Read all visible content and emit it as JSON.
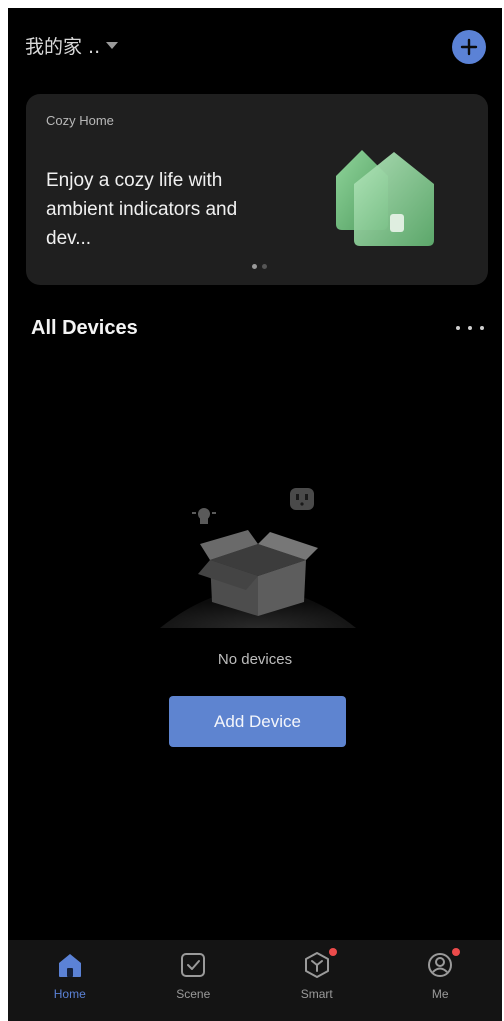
{
  "header": {
    "home_name": "我的家 ..",
    "add_icon": "plus-icon"
  },
  "banner": {
    "eyebrow": "Cozy Home",
    "headline": "Enjoy a cozy life with ambient indicators and dev...",
    "page_count": 2,
    "active_page": 1
  },
  "devices": {
    "title": "All Devices",
    "more_icon": "more-horizontal-icon",
    "empty_text": "No devices",
    "add_button": "Add Device"
  },
  "tabbar": {
    "items": [
      {
        "label": "Home",
        "icon": "home-icon",
        "active": true,
        "badge": false
      },
      {
        "label": "Scene",
        "icon": "scene-checkbox-icon",
        "active": false,
        "badge": false
      },
      {
        "label": "Smart",
        "icon": "smart-cube-icon",
        "active": false,
        "badge": true
      },
      {
        "label": "Me",
        "icon": "profile-icon",
        "active": false,
        "badge": true
      }
    ]
  },
  "colors": {
    "accent": "#5b82d6",
    "background": "#000000",
    "card": "#1f1f1f",
    "badge": "#ec4b4b"
  }
}
